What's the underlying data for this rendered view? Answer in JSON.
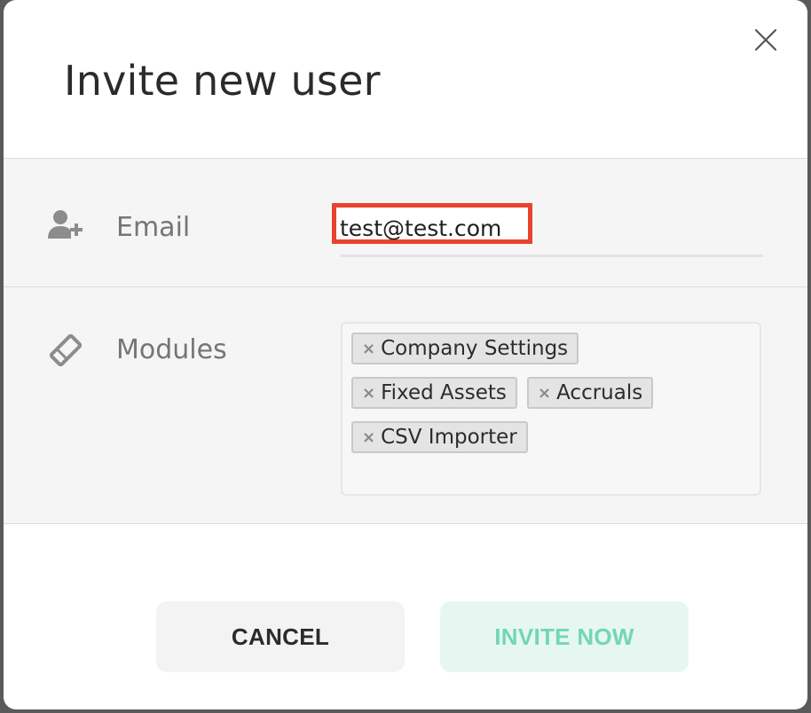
{
  "dialog": {
    "title": "Invite new user",
    "close_icon": "close-icon"
  },
  "email": {
    "label": "Email",
    "icon": "user-plus-icon",
    "value": "test@test.com",
    "highlight_color": "#e8432d"
  },
  "modules": {
    "label": "Modules",
    "icon": "ticket-icon",
    "tags": [
      {
        "label": "Company Settings"
      },
      {
        "label": "Fixed Assets"
      },
      {
        "label": "Accruals"
      },
      {
        "label": "CSV Importer"
      }
    ],
    "remove_glyph": "×"
  },
  "actions": {
    "cancel_label": "CANCEL",
    "invite_label": "INVITE NOW",
    "invite_color": "#73d6b5",
    "invite_bg": "#e6f7f2"
  }
}
